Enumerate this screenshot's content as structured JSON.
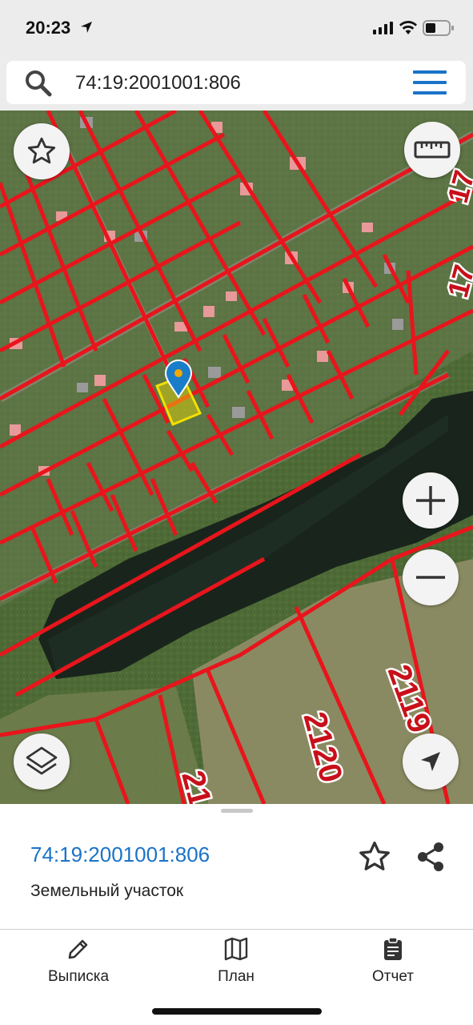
{
  "status_bar": {
    "time": "20:23"
  },
  "search": {
    "value": "74:19:2001001:806"
  },
  "map": {
    "labels": [
      "17",
      "17",
      "2119",
      "2120",
      "21"
    ],
    "parcel_highlight_color": "#f2e100",
    "boundary_color": "#e8151c",
    "pin_color": "#1a7dc9",
    "icons": {
      "favorite": "star-icon",
      "ruler": "ruler-icon",
      "zoom_in": "plus-icon",
      "zoom_out": "minus-icon",
      "layers": "layers-icon",
      "locate": "navigation-arrow-icon"
    }
  },
  "parcel": {
    "id": "74:19:2001001:806",
    "type": "Земельный участок"
  },
  "tabs": [
    {
      "label": "Выписка",
      "icon": "pencil-icon"
    },
    {
      "label": "План",
      "icon": "map-icon"
    },
    {
      "label": "Отчет",
      "icon": "clipboard-icon"
    }
  ],
  "colors": {
    "accent": "#1a73c8",
    "header_bg": "#ececec"
  }
}
